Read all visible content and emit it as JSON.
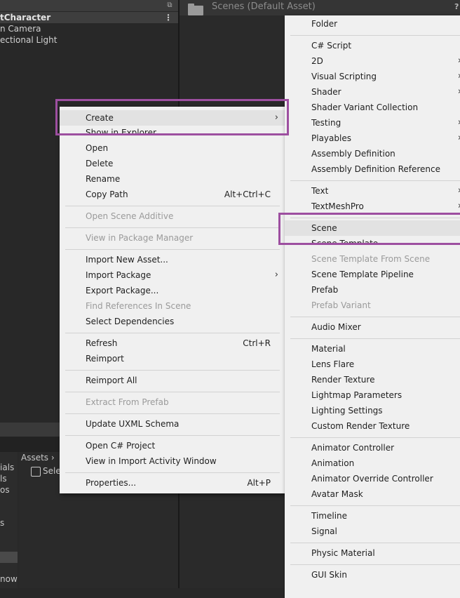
{
  "hierarchy": {
    "scene_name": "tCharacter",
    "items": [
      "n Camera",
      "ectional Light"
    ]
  },
  "project": {
    "path": "Scenes (Default Asset)",
    "breadcrumb": "Assets",
    "selected_item": "Sele",
    "left_items": [
      "ials",
      "ls",
      "os",
      "s",
      "now"
    ]
  },
  "context_menu": {
    "items": [
      {
        "label": "Create",
        "arrow": true,
        "hover": true
      },
      {
        "label": "Show in Explorer"
      },
      {
        "label": "Open"
      },
      {
        "label": "Delete"
      },
      {
        "label": "Rename"
      },
      {
        "label": "Copy Path",
        "shortcut": "Alt+Ctrl+C"
      },
      {
        "label": "Open Scene Additive",
        "disabled": true
      },
      {
        "label": "View in Package Manager",
        "disabled": true
      },
      {
        "label": "Import New Asset..."
      },
      {
        "label": "Import Package",
        "arrow": true
      },
      {
        "label": "Export Package..."
      },
      {
        "label": "Find References In Scene",
        "disabled": true
      },
      {
        "label": "Select Dependencies"
      },
      {
        "label": "Refresh",
        "shortcut": "Ctrl+R"
      },
      {
        "label": "Reimport"
      },
      {
        "label": "Reimport All"
      },
      {
        "label": "Extract From Prefab",
        "disabled": true
      },
      {
        "label": "Update UXML Schema"
      },
      {
        "label": "Open C# Project"
      },
      {
        "label": "View in Import Activity Window"
      },
      {
        "label": "Properties...",
        "shortcut": "Alt+P"
      }
    ]
  },
  "create_submenu": {
    "items": [
      {
        "label": "Folder"
      },
      {
        "label": "C# Script"
      },
      {
        "label": "2D",
        "arrow": true
      },
      {
        "label": "Visual Scripting",
        "arrow": true
      },
      {
        "label": "Shader",
        "arrow": true
      },
      {
        "label": "Shader Variant Collection"
      },
      {
        "label": "Testing",
        "arrow": true
      },
      {
        "label": "Playables",
        "arrow": true
      },
      {
        "label": "Assembly Definition"
      },
      {
        "label": "Assembly Definition Reference"
      },
      {
        "label": "Text",
        "arrow": true
      },
      {
        "label": "TextMeshPro",
        "arrow": true
      },
      {
        "label": "Scene",
        "hover": true
      },
      {
        "label": "Scene Template"
      },
      {
        "label": "Scene Template From Scene",
        "disabled": true
      },
      {
        "label": "Scene Template Pipeline"
      },
      {
        "label": "Prefab"
      },
      {
        "label": "Prefab Variant",
        "disabled": true
      },
      {
        "label": "Audio Mixer"
      },
      {
        "label": "Material"
      },
      {
        "label": "Lens Flare"
      },
      {
        "label": "Render Texture"
      },
      {
        "label": "Lightmap Parameters"
      },
      {
        "label": "Lighting Settings"
      },
      {
        "label": "Custom Render Texture"
      },
      {
        "label": "Animator Controller"
      },
      {
        "label": "Animation"
      },
      {
        "label": "Animator Override Controller"
      },
      {
        "label": "Avatar Mask"
      },
      {
        "label": "Timeline"
      },
      {
        "label": "Signal"
      },
      {
        "label": "Physic Material"
      },
      {
        "label": "GUI Skin"
      }
    ]
  },
  "colors": {
    "highlight_box": "#9d4fa0",
    "menu_bg": "#f0f0f0",
    "editor_bg": "#282828"
  }
}
